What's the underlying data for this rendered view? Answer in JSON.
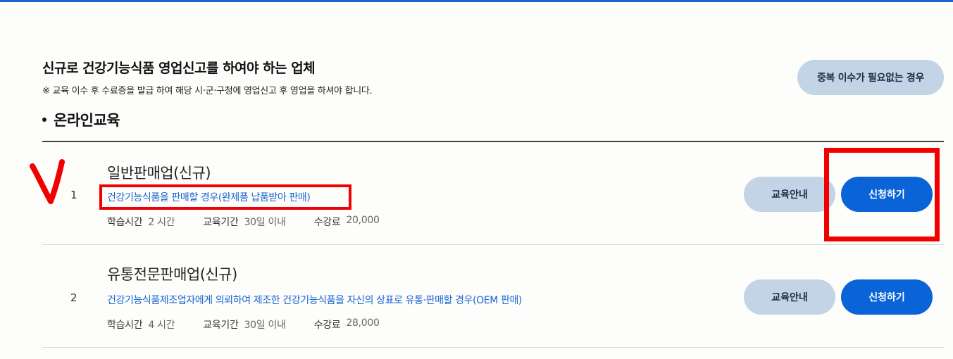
{
  "page": {
    "heading": "신규로 건강기능식품 영업신고를 하여야 하는 업체",
    "note": "※ 교육 이수 후 수료증을 발급 하여 해당 시·군·구청에 영업신고 후 영업을 하셔야 합니다.",
    "no_duplicate_button": "중복 이수가 필요없는 경우",
    "section_title": "온라인교육"
  },
  "labels": {
    "study_time": "학습시간",
    "period": "교육기간",
    "fee": "수강료",
    "info_button": "교육안내",
    "apply_button": "신청하기"
  },
  "courses": [
    {
      "number": "1",
      "title": "일반판매업(신규)",
      "description": "건강기능식품을 판매할 경우(완제품 납품받아 판매)",
      "study_time": "2 시간",
      "period": "30일 이내",
      "fee": "20,000"
    },
    {
      "number": "2",
      "title": "유통전문판매업(신규)",
      "description": "건강기능식품제조업자에게 의뢰하여 제조한 건강기능식품을 자신의 상표로 유통·판매할 경우(OEM 판매)",
      "study_time": "4 시간",
      "period": "30일 이내",
      "fee": "28,000"
    }
  ],
  "colors": {
    "accent": "#0a64d8",
    "secondary_button": "#c3d4e6",
    "link": "#1763d0",
    "annotation": "#f20000"
  }
}
